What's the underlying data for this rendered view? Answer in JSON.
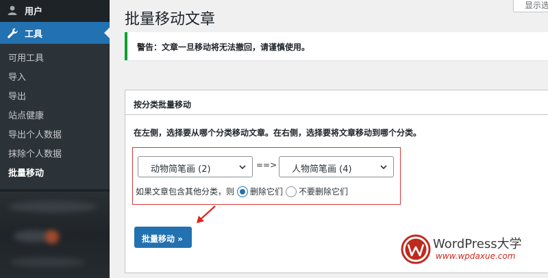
{
  "sidebar": {
    "users_label": "用户",
    "tools_label": "工具",
    "submenu": [
      {
        "label": "可用工具"
      },
      {
        "label": "导入"
      },
      {
        "label": "导出"
      },
      {
        "label": "站点健康"
      },
      {
        "label": "导出个人数据"
      },
      {
        "label": "抹除个人数据"
      },
      {
        "label": "批量移动"
      }
    ],
    "current_index": 6
  },
  "header": {
    "title": "批量移动文章",
    "screen_options": "显示选项"
  },
  "notice": {
    "text": "警告：文章一旦移动将无法撤回，请谨慎使用。"
  },
  "panel": {
    "heading": "按分类批量移动",
    "description": "在左侧，选择要从哪个分类移动文章。在右侧，选择要将文章移动到哪个分类。",
    "from_select": "动物简笔画 (2)",
    "arrow": "==>",
    "to_select": "人物简笔画 (4)",
    "other_cat_label": "如果文章包含其他分类，则",
    "opt_delete": "删除它们",
    "opt_keep": "不要删除它们",
    "selected_option": "delete",
    "submit_label": "批量移动 »"
  },
  "watermark": {
    "title": "WordPress大学",
    "url": "www.wpdaxue.com"
  },
  "colors": {
    "sidebar_bg": "#1d2327",
    "accent": "#2271b1",
    "notice_border": "#00a32a",
    "highlight_red": "#d63638"
  }
}
